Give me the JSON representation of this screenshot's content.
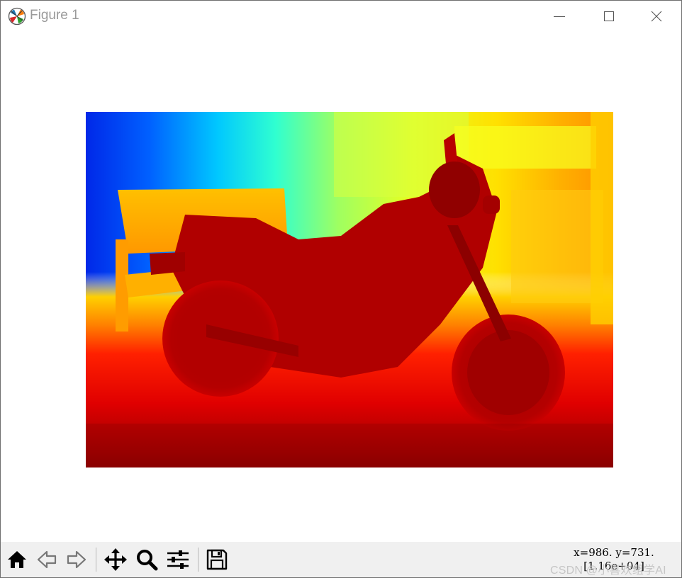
{
  "window": {
    "title": "Figure 1"
  },
  "status": {
    "coords_line1": "x=986. y=731.",
    "coords_line2": "[1.16e+04]"
  },
  "watermark": {
    "text": "CSDN @小喜欢组学AI"
  },
  "toolbar": {
    "tools": [
      "home-icon",
      "back-arrow-icon",
      "forward-arrow-icon",
      "pan-move-icon",
      "zoom-magnifier-icon",
      "subplots-configure-icon",
      "save-floppy-icon"
    ]
  },
  "figure": {
    "colormap": "jet"
  }
}
